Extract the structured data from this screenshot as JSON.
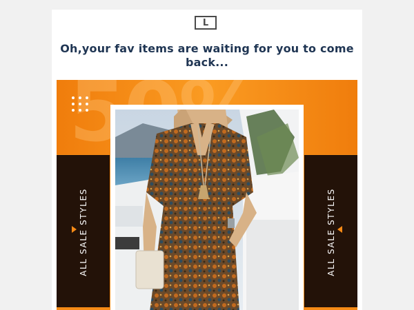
{
  "email": {
    "logo_letter": "L",
    "headline": "Oh,your fav items are waiting for you to come back...",
    "banner": {
      "ghost_text": "50%",
      "left_cta": "ALL SALE STYLES",
      "right_cta": "ALL SALE STYLES"
    }
  },
  "colors": {
    "accent_orange": "#f58a16",
    "dark_panel": "#231208",
    "headline_navy": "#1f3553"
  },
  "icons": {
    "logo": "letter-l-logo-icon",
    "dots": "dot-grid-icon",
    "left_arrow": "triangle-right-icon",
    "right_arrow": "triangle-left-icon"
  }
}
